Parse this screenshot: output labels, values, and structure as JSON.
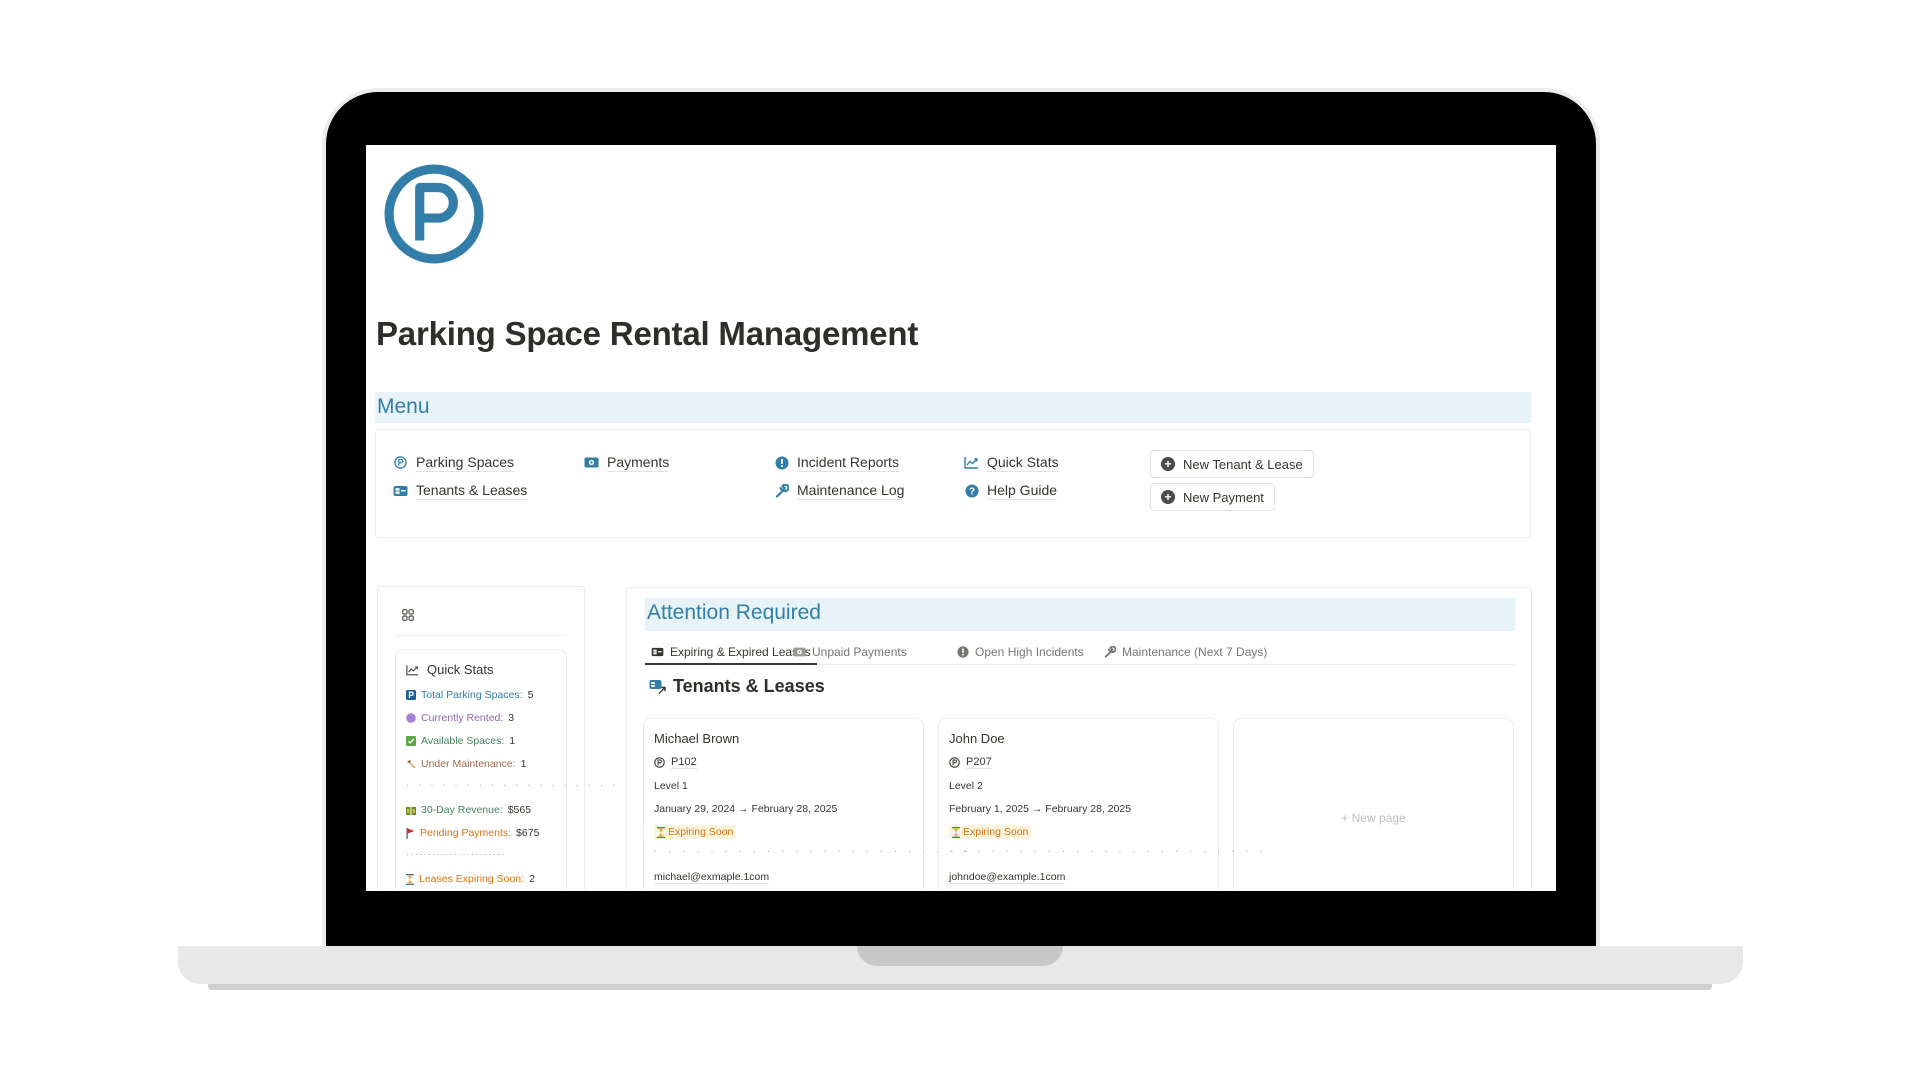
{
  "page": {
    "title": "Parking Space Rental Management",
    "logo_icon": "parking-circle-icon",
    "accent_color": "#337ea9"
  },
  "menu": {
    "heading": "Menu",
    "links": [
      {
        "label": "Parking Spaces",
        "icon": "parking-circle-icon"
      },
      {
        "label": "Tenants & Leases",
        "icon": "id-card-icon"
      },
      {
        "label": "Payments",
        "icon": "money-bill-icon"
      },
      {
        "label": "Incident Reports",
        "icon": "exclamation-badge-icon"
      },
      {
        "label": "Maintenance Log",
        "icon": "wrench-icon"
      },
      {
        "label": "Quick Stats",
        "icon": "chart-line-icon"
      },
      {
        "label": "Help Guide",
        "icon": "question-circle-icon"
      }
    ],
    "buttons": [
      {
        "label": "New Tenant & Lease",
        "icon": "plus-circle-icon"
      },
      {
        "label": "New Payment",
        "icon": "plus-circle-icon"
      }
    ]
  },
  "sidebar": {
    "icon": "grid-icon",
    "quick_stats": {
      "title": "Quick Stats",
      "items": [
        {
          "label": "Total Parking Spaces:",
          "value": "5",
          "icon": "parking-square-icon",
          "color": "#337ea9"
        },
        {
          "label": "Currently Rented:",
          "value": "3",
          "icon": "purple-circle-icon",
          "color": "#9065b0"
        },
        {
          "label": "Available Spaces:",
          "value": "1",
          "icon": "check-box-icon",
          "color": "#448361"
        },
        {
          "label": "Under Maintenance:",
          "value": "1",
          "icon": "hammer-icon",
          "color": "#9f6b53"
        },
        {
          "label": "30-Day Revenue:",
          "value": "$565",
          "icon": "money-icon",
          "color": "#448361"
        },
        {
          "label": "Pending Payments:",
          "value": "$675",
          "icon": "red-flag-icon",
          "color": "#d9730d"
        },
        {
          "label": "Leases Expiring Soon:",
          "value": "2",
          "icon": "hourglass-icon",
          "color": "#d9730d"
        }
      ],
      "separator": "· · · · · · · · · · · · · · · · · ·",
      "separator_short": "·······················"
    }
  },
  "attention": {
    "heading": "Attention Required",
    "tabs": [
      {
        "label": "Expiring & Expired Leases",
        "icon": "id-card-icon",
        "active": true
      },
      {
        "label": "Unpaid Payments",
        "icon": "money-bill-icon",
        "active": false
      },
      {
        "label": "Open High Incidents",
        "icon": "exclamation-badge-icon",
        "active": false
      },
      {
        "label": "Maintenance (Next 7 Days)",
        "icon": "wrench-icon",
        "active": false
      }
    ],
    "section_title": "Tenants & Leases",
    "cards": [
      {
        "name": "Michael Brown",
        "space": "P102",
        "level": "Level 1",
        "dates": "January 29, 2024 → February 28, 2025",
        "status": "Expiring Soon",
        "separator": "· · · · · · · · · · · · · · · · · · · · · · ·",
        "email": "michael@exmaple.1com"
      },
      {
        "name": "John Doe",
        "space": "P207",
        "level": "Level 2",
        "dates": "February 1, 2025 → February 28, 2025",
        "status": "Expiring Soon",
        "separator": "· · · · · · · · · · · · · · · · · · · · · · ·",
        "email": "johndoe@example.1com"
      }
    ],
    "new_page_label": "New page"
  }
}
